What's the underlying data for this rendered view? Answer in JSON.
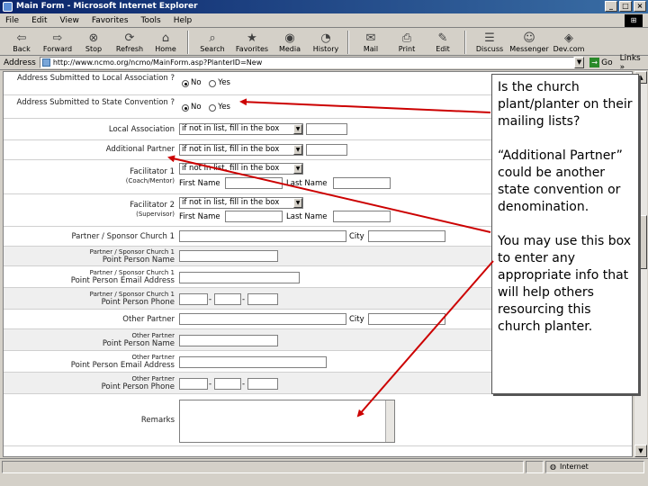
{
  "window": {
    "title": "Main Form - Microsoft Internet Explorer",
    "buttons": [
      "_",
      "□",
      "×"
    ]
  },
  "menu": [
    "File",
    "Edit",
    "View",
    "Favorites",
    "Tools",
    "Help"
  ],
  "toolbar": [
    {
      "label": "Back",
      "icon": "back-arrow-icon"
    },
    {
      "label": "Forward",
      "icon": "forward-arrow-icon"
    },
    {
      "label": "Stop",
      "icon": "stop-icon"
    },
    {
      "label": "Refresh",
      "icon": "refresh-icon"
    },
    {
      "label": "Home",
      "icon": "home-icon"
    },
    {
      "label": "Search",
      "icon": "search-icon"
    },
    {
      "label": "Favorites",
      "icon": "favorites-icon"
    },
    {
      "label": "Media",
      "icon": "media-icon"
    },
    {
      "label": "History",
      "icon": "history-icon"
    },
    {
      "label": "Mail",
      "icon": "mail-icon"
    },
    {
      "label": "Print",
      "icon": "print-icon"
    },
    {
      "label": "Edit",
      "icon": "edit-icon"
    },
    {
      "label": "Discuss",
      "icon": "discuss-icon"
    },
    {
      "label": "Messenger",
      "icon": "messenger-icon"
    },
    {
      "label": "Dev.com",
      "icon": "devcom-icon"
    }
  ],
  "address": {
    "label": "Address",
    "url": "http://www.ncmo.org/ncmo/MainForm.asp?PlanterID=New",
    "go": "Go",
    "links": "Links »"
  },
  "form": {
    "address_submitted": "Address Submitted to Local Association ?",
    "address_submitted_state": "Address Submitted to State Convention ?",
    "no": "No",
    "yes": "Yes",
    "local_association": "Local Association",
    "select_hint": "if not in list, fill in the box",
    "additional_partner": "Additional Partner",
    "facilitator1": "Facilitator 1",
    "facilitator1_sub": "(Coach/Mentor)",
    "facilitator2": "Facilitator 2",
    "facilitator2_sub": "(Supervisor)",
    "first_name": "First Name",
    "last_name": "Last Name",
    "partner_church1": "Partner / Sponsor Church 1",
    "city": "City",
    "contact_name_a": "Partner / Sponsor Church 1",
    "contact_name_b": "Point Person Name",
    "contact_email_a": "Partner / Sponsor Church 1",
    "contact_email_b": "Point Person Email Address",
    "contact_phone_a": "Partner / Sponsor Church 1",
    "contact_phone_b": "Point Person Phone",
    "other_partner": "Other Partner",
    "other_name_a": "Other Partner",
    "other_name_b": "Point Person Name",
    "other_email_a": "Other Partner",
    "other_email_b": "Point Person Email Address",
    "other_phone_a": "Other Partner",
    "other_phone_b": "Point Person Phone",
    "remarks": "Remarks",
    "dash": "-"
  },
  "callout": {
    "p1": "Is the church plant/planter on their mailing lists?",
    "p2": "“Additional Partner” could be another state convention or denomination.",
    "p3": "You may use this box to enter any appropriate info that will help others resourcing this church planter."
  },
  "status": {
    "zone": "Internet"
  },
  "colors": {
    "titlebar": "#0a246a",
    "chrome": "#d4d0c8",
    "arrow": "#cc0000"
  }
}
